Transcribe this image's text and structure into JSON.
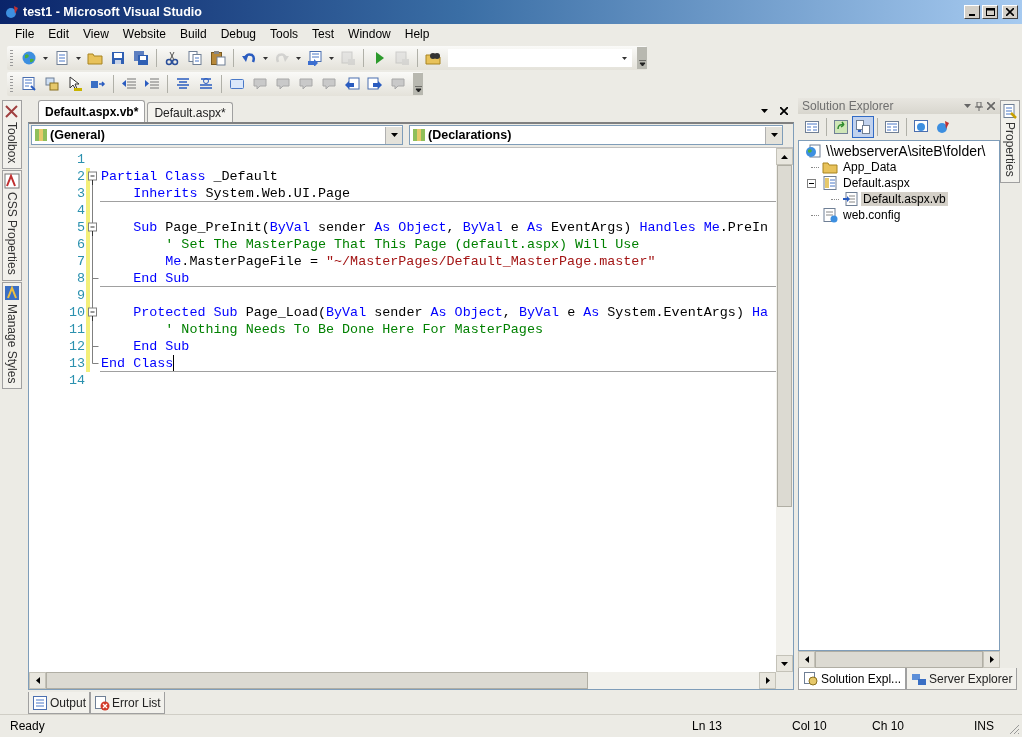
{
  "window": {
    "title": "test1 - Microsoft Visual Studio"
  },
  "menu": [
    "File",
    "Edit",
    "View",
    "Website",
    "Build",
    "Debug",
    "Tools",
    "Test",
    "Window",
    "Help"
  ],
  "side_tabs_left": [
    {
      "label": "Toolbox"
    },
    {
      "label": "CSS Properties"
    },
    {
      "label": "Manage Styles"
    }
  ],
  "document_tabs": [
    {
      "label": "Default.aspx.vb*",
      "selected": true
    },
    {
      "label": "Default.aspx*",
      "selected": false
    }
  ],
  "editor": {
    "class_dropdown": "(General)",
    "member_dropdown": "(Declarations)",
    "lines": [
      {
        "number": "1",
        "kind": "blank",
        "changed": false,
        "rule": false,
        "caret": false
      },
      {
        "number": "2",
        "kind": "fold-start",
        "changed": true,
        "rule": false,
        "caret": false,
        "tokens": [
          {
            "kind": "keyword",
            "text": "Partial Class"
          },
          {
            "kind": "plain",
            "text": " _Default"
          }
        ]
      },
      {
        "number": "3",
        "kind": "guide",
        "changed": true,
        "rule": true,
        "caret": false,
        "tokens": [
          {
            "kind": "keyword",
            "text": "    Inherits"
          },
          {
            "kind": "plain",
            "text": " System.Web.UI.Page"
          }
        ]
      },
      {
        "number": "4",
        "kind": "guide",
        "changed": true,
        "rule": false,
        "caret": false
      },
      {
        "number": "5",
        "kind": "fold-start",
        "changed": true,
        "rule": false,
        "caret": false,
        "tokens": [
          {
            "kind": "keyword",
            "text": "    Sub"
          },
          {
            "kind": "plain",
            "text": " Page_PreInit("
          },
          {
            "kind": "keyword",
            "text": "ByVal"
          },
          {
            "kind": "plain",
            "text": " sender "
          },
          {
            "kind": "keyword",
            "text": "As Object"
          },
          {
            "kind": "plain",
            "text": ", "
          },
          {
            "kind": "keyword",
            "text": "ByVal"
          },
          {
            "kind": "plain",
            "text": " e "
          },
          {
            "kind": "keyword",
            "text": "As"
          },
          {
            "kind": "plain",
            "text": " EventArgs) "
          },
          {
            "kind": "keyword",
            "text": "Handles Me"
          },
          {
            "kind": "plain",
            "text": ".PreIn"
          }
        ]
      },
      {
        "number": "6",
        "kind": "guide",
        "changed": true,
        "rule": false,
        "caret": false,
        "tokens": [
          {
            "kind": "comment",
            "text": "        ' Set The MasterPage That This Page (default.aspx) Will Use"
          }
        ]
      },
      {
        "number": "7",
        "kind": "guide",
        "changed": true,
        "rule": false,
        "caret": false,
        "tokens": [
          {
            "kind": "keyword",
            "text": "        Me"
          },
          {
            "kind": "plain",
            "text": ".MasterPageFile = "
          },
          {
            "kind": "string",
            "text": "\"~/MasterPages/Default_MasterPage.master\""
          }
        ]
      },
      {
        "number": "8",
        "kind": "guide-tick",
        "changed": true,
        "rule": true,
        "caret": false,
        "tokens": [
          {
            "kind": "keyword",
            "text": "    End Sub"
          }
        ]
      },
      {
        "number": "9",
        "kind": "guide",
        "changed": true,
        "rule": false,
        "caret": false
      },
      {
        "number": "10",
        "kind": "fold-start",
        "changed": true,
        "rule": false,
        "caret": false,
        "tokens": [
          {
            "kind": "keyword",
            "text": "    Protected Sub"
          },
          {
            "kind": "plain",
            "text": " Page_Load("
          },
          {
            "kind": "keyword",
            "text": "ByVal"
          },
          {
            "kind": "plain",
            "text": " sender "
          },
          {
            "kind": "keyword",
            "text": "As Object"
          },
          {
            "kind": "plain",
            "text": ", "
          },
          {
            "kind": "keyword",
            "text": "ByVal"
          },
          {
            "kind": "plain",
            "text": " e "
          },
          {
            "kind": "keyword",
            "text": "As"
          },
          {
            "kind": "plain",
            "text": " System.EventArgs) "
          },
          {
            "kind": "keyword",
            "text": "Ha"
          }
        ]
      },
      {
        "number": "11",
        "kind": "guide",
        "changed": true,
        "rule": false,
        "caret": false,
        "tokens": [
          {
            "kind": "comment",
            "text": "        ' Nothing Needs To Be Done Here For MasterPages"
          }
        ]
      },
      {
        "number": "12",
        "kind": "guide-tick",
        "changed": true,
        "rule": false,
        "caret": false,
        "tokens": [
          {
            "kind": "keyword",
            "text": "    End Sub"
          }
        ]
      },
      {
        "number": "13",
        "kind": "block-end",
        "changed": true,
        "rule": true,
        "caret": true,
        "tokens": [
          {
            "kind": "keyword",
            "text": "End Class"
          }
        ]
      },
      {
        "number": "14",
        "kind": "blank",
        "changed": false,
        "rule": false,
        "caret": false
      }
    ]
  },
  "solution_explorer": {
    "title": "Solution Explorer",
    "tree": [
      {
        "label": "\\\\webserverA\\siteB\\folder\\",
        "kind": "web",
        "selected": false,
        "children": [
          {
            "label": "App_Data",
            "kind": "folder",
            "selected": false
          },
          {
            "label": "Default.aspx",
            "kind": "page",
            "expanded": true,
            "selected": false,
            "children": [
              {
                "label": "Default.aspx.vb",
                "kind": "code",
                "selected": true
              }
            ]
          },
          {
            "label": "web.config",
            "kind": "config",
            "selected": false
          }
        ]
      }
    ],
    "tabs": [
      {
        "label": "Solution Expl...",
        "selected": true
      },
      {
        "label": "Server Explorer",
        "selected": false
      }
    ]
  },
  "side_tabs_right": [
    {
      "label": "Properties"
    }
  ],
  "bottom_tabs": [
    {
      "label": "Output"
    },
    {
      "label": "Error List"
    }
  ],
  "status_bar": {
    "message": "Ready",
    "line": "Ln 13",
    "column": "Col 10",
    "char": "Ch 10",
    "mode": "INS"
  }
}
